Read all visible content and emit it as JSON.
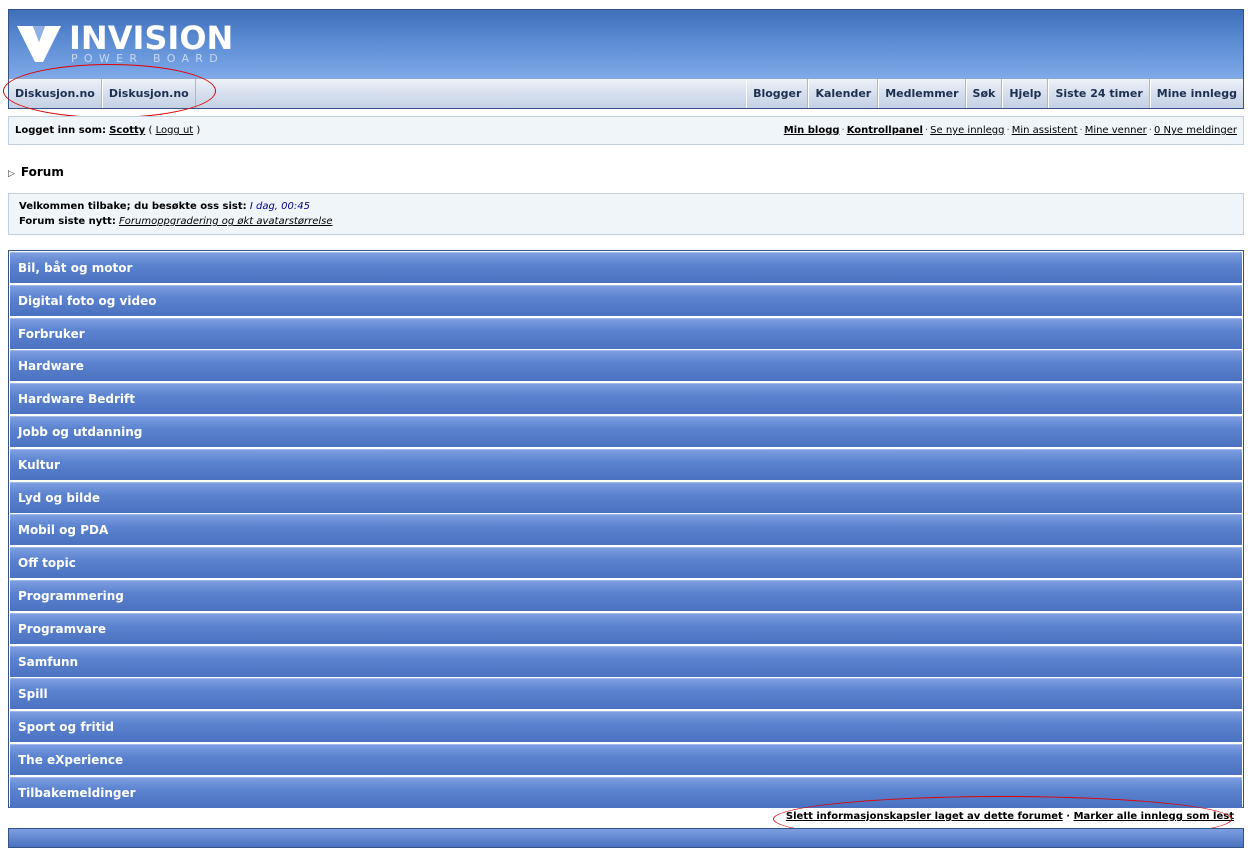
{
  "logo": {
    "word": "INVISION",
    "sub": "POWER BOARD"
  },
  "nav": {
    "left": [
      "Diskusjon.no",
      "Diskusjon.no"
    ],
    "right": [
      "Blogger",
      "Kalender",
      "Medlemmer",
      "Søk",
      "Hjelp",
      "Siste 24 timer",
      "Mine innlegg"
    ]
  },
  "userbar": {
    "logged_in_label": "Logget inn som:",
    "username": "Scotty",
    "logout": "Logg ut",
    "links": [
      "Min blogg",
      "Kontrollpanel",
      "Se nye innlegg",
      "Min assistent",
      "Mine venner",
      "0 Nye meldinger"
    ]
  },
  "breadcrumb": {
    "arrow": "▷",
    "label": "Forum"
  },
  "welcome": {
    "visit_label": "Velkommen tilbake; du besøkte oss sist:",
    "visit_value": "I dag, 00:45",
    "news_label": "Forum siste nytt:",
    "news_link": "Forumoppgradering og økt avatarstørrelse"
  },
  "forums": [
    "Bil, båt og motor",
    "Digital foto og video",
    "Forbruker",
    "Hardware",
    "Hardware Bedrift",
    "Jobb og utdanning",
    "Kultur",
    "Lyd og bilde",
    "Mobil og PDA",
    "Off topic",
    "Programmering",
    "Programvare",
    "Samfunn",
    "Spill",
    "Sport og fritid",
    "The eXperience",
    "Tilbakemeldinger"
  ],
  "bottom": {
    "delete_cookies": "Slett informasjonskapsler laget av dette forumet",
    "mark_read": "Marker alle innlegg som lest"
  },
  "colors": {
    "header_blue": "#5b8bd3",
    "category_blue": "#5a82cf",
    "annotation_red": "#e00000"
  }
}
